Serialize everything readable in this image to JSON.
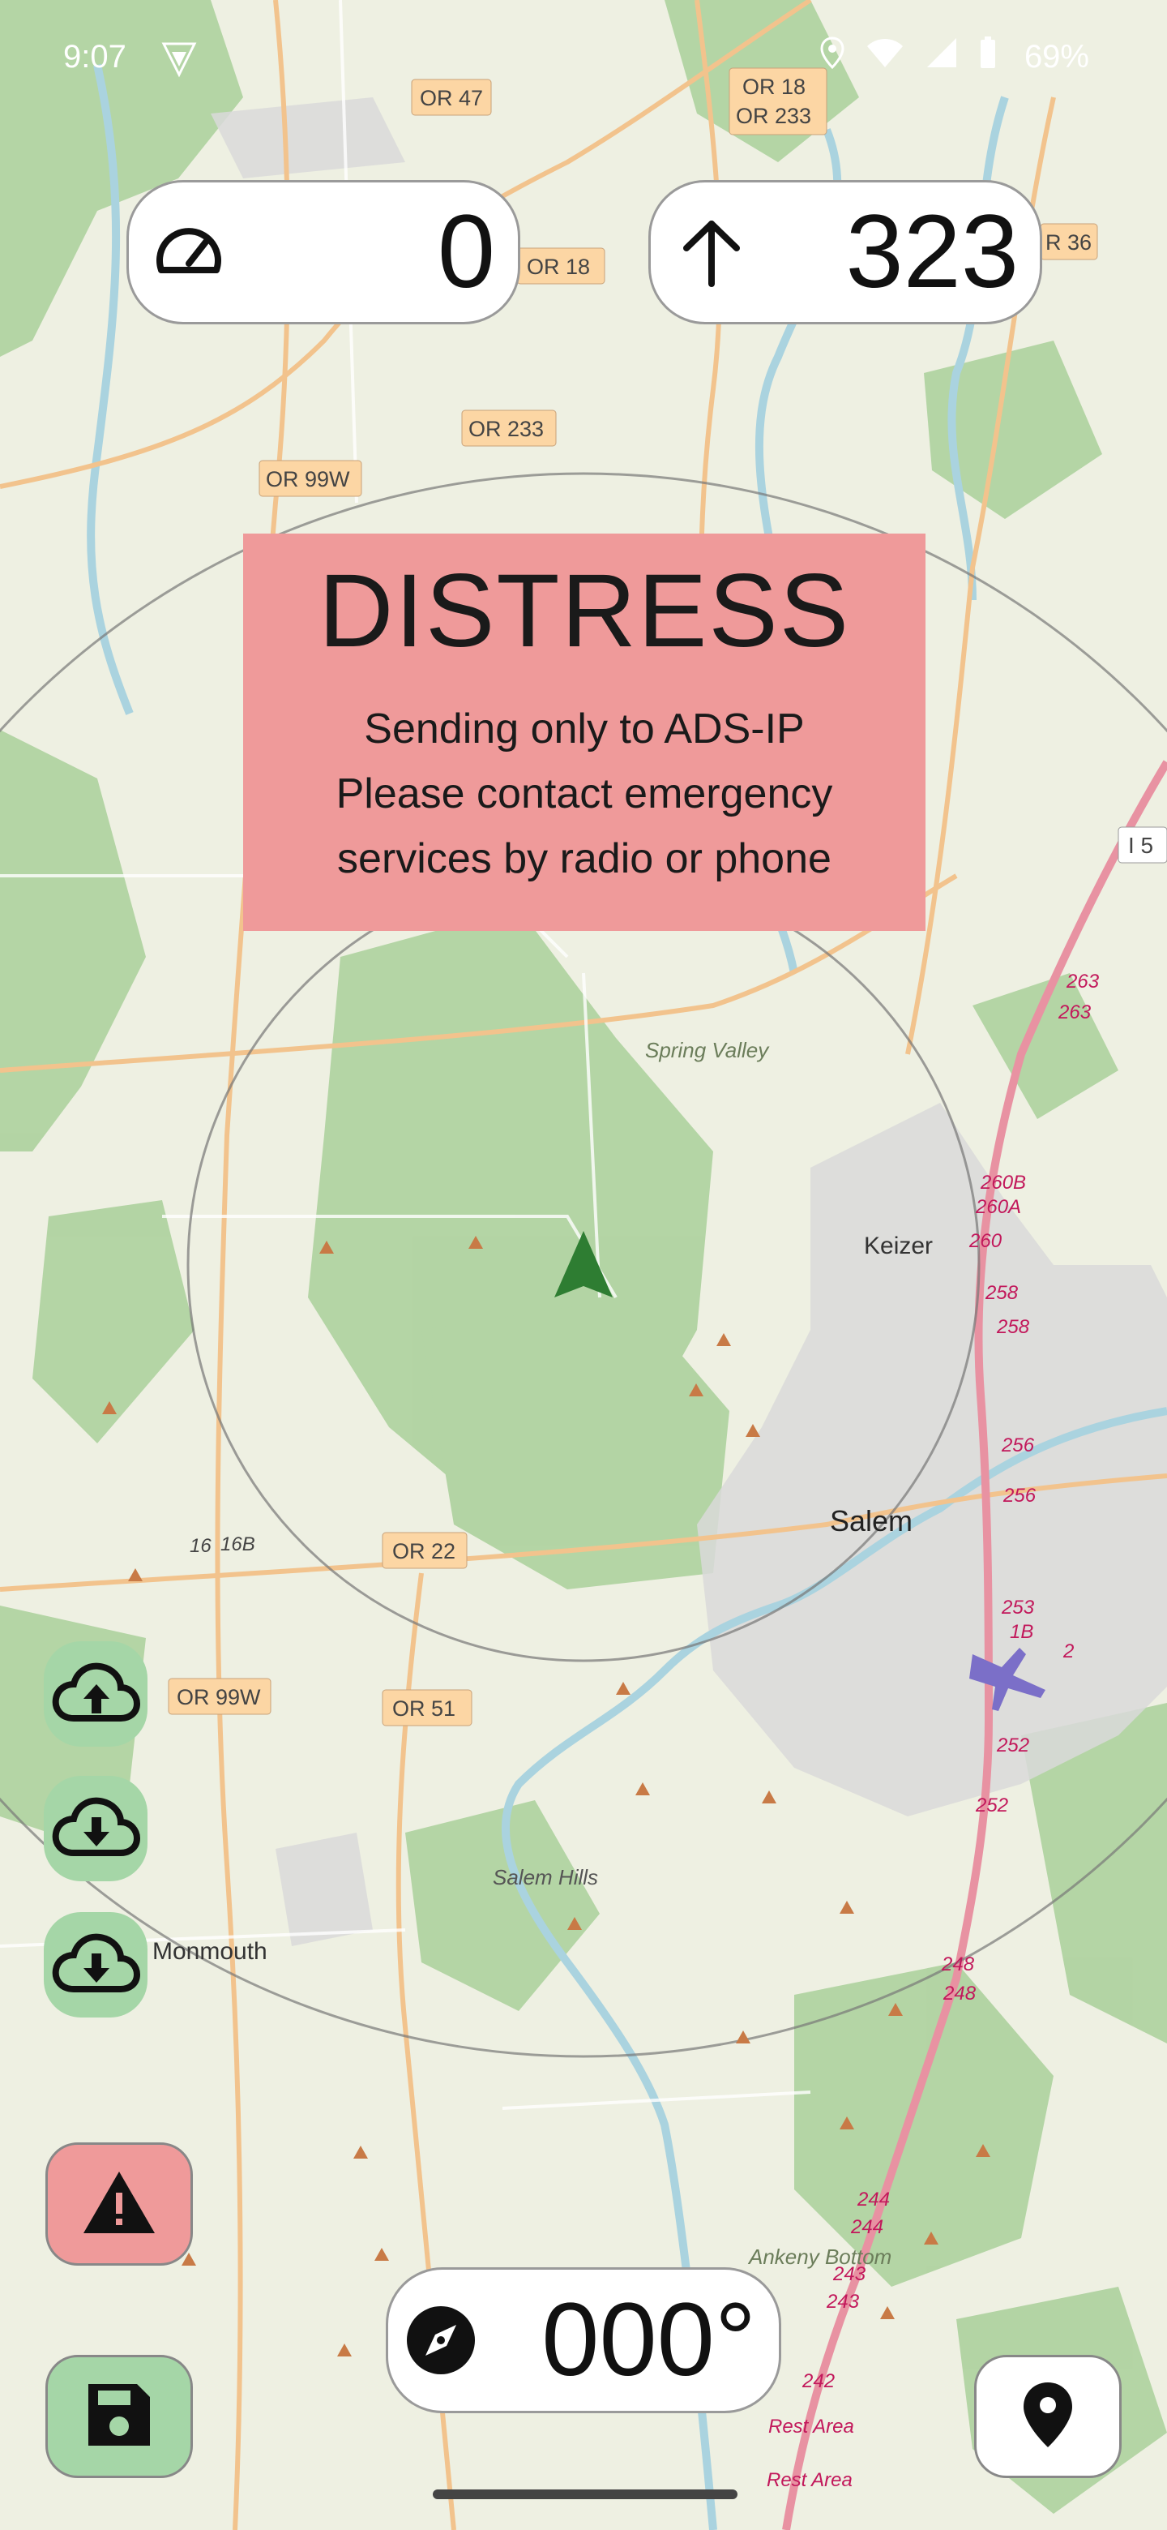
{
  "status_bar": {
    "time": "9:07",
    "battery": "69%",
    "icons": [
      "vpn-icon",
      "location-icon",
      "wifi-icon",
      "signal-icon",
      "battery-icon"
    ]
  },
  "speed": {
    "icon": "speedometer-icon",
    "value": "0"
  },
  "altitude": {
    "icon": "arrow-up-icon",
    "value": "323"
  },
  "heading": {
    "icon": "compass-icon",
    "value": "000°"
  },
  "distress": {
    "title": "DISTRESS",
    "line1": "Sending only to ADS-IP",
    "line2": "Please contact emergency",
    "line3": "services by radio or phone"
  },
  "side_buttons": [
    {
      "icon": "cloud-upload-icon"
    },
    {
      "icon": "cloud-download-icon"
    },
    {
      "icon": "cloud-download-icon"
    }
  ],
  "bottom_buttons": {
    "alert": {
      "icon": "warning-icon",
      "color": "#ef9a9a"
    },
    "save": {
      "icon": "save-icon",
      "color": "#a5d6a7"
    },
    "location": {
      "icon": "map-pin-icon",
      "color": "#ffffff"
    }
  },
  "map": {
    "road_labels": [
      "OR 47",
      "OR 18",
      "OR 233",
      "OR 18",
      "R 36",
      "OR 233",
      "OR 99W",
      "I 5",
      "263",
      "263",
      "260B",
      "260A",
      "260",
      "258",
      "258",
      "256",
      "256",
      "253",
      "1B",
      "2",
      "252",
      "252",
      "248",
      "248",
      "244",
      "244",
      "243",
      "243",
      "242",
      "16",
      "16B",
      "OR 22",
      "OR 99W",
      "OR 51"
    ],
    "place_labels": [
      "Spring Valley",
      "Keizer",
      "Salem",
      "Salem Hills",
      "Monmouth",
      "Ankeny Bottom",
      "Rest Area",
      "Rest Area"
    ],
    "colors": {
      "land": "#eef0e2",
      "forest": "#add19e",
      "urban": "#d9d9d9",
      "water": "#aad3df",
      "motorway": "#e892a2",
      "primary": "#fcd6a4",
      "aircraft": "#2e7d32"
    }
  }
}
